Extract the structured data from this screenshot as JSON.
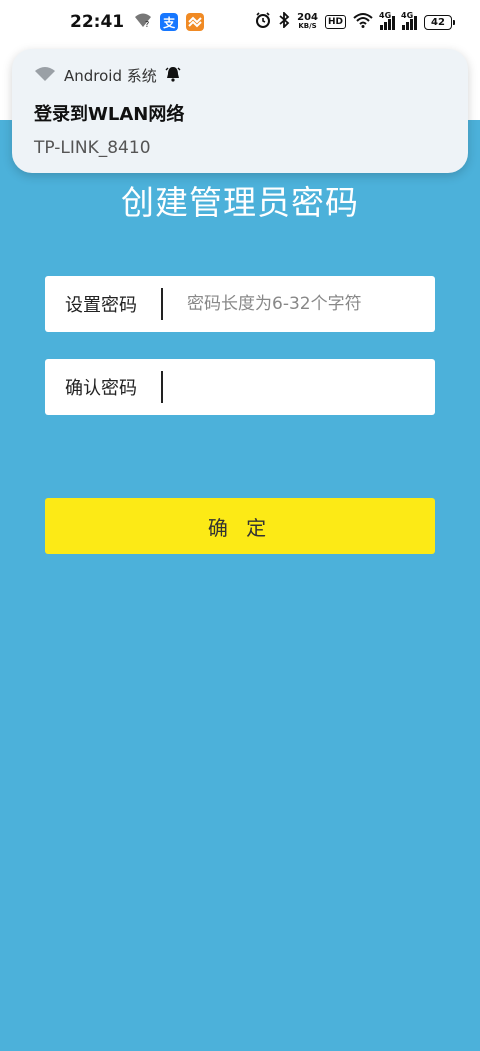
{
  "status_bar": {
    "time": "22:41",
    "network_speed": "204",
    "network_speed_unit": "KB/S",
    "hd_badge": "HD",
    "signal1_label": "4G",
    "signal2_label": "4G",
    "battery": "42",
    "icons": [
      "wifi-question-icon",
      "alipay-app-icon",
      "orange-app-icon",
      "alarm-icon",
      "bluetooth-icon",
      "hd-icon",
      "wifi-icon",
      "signal-icon",
      "battery-icon"
    ]
  },
  "notification": {
    "app_name": "Android 系统",
    "title": "登录到WLAN网络",
    "text": "TP-LINK_8410"
  },
  "page": {
    "title": "创建管理员密码",
    "set_password_label": "设置密码",
    "set_password_placeholder": "密码长度为6-32个字符",
    "confirm_password_label": "确认密码",
    "confirm_password_value": "",
    "confirm_button": "确 定"
  },
  "colors": {
    "background": "#4cb1da",
    "button": "#fcea16",
    "field": "#ffffff"
  }
}
